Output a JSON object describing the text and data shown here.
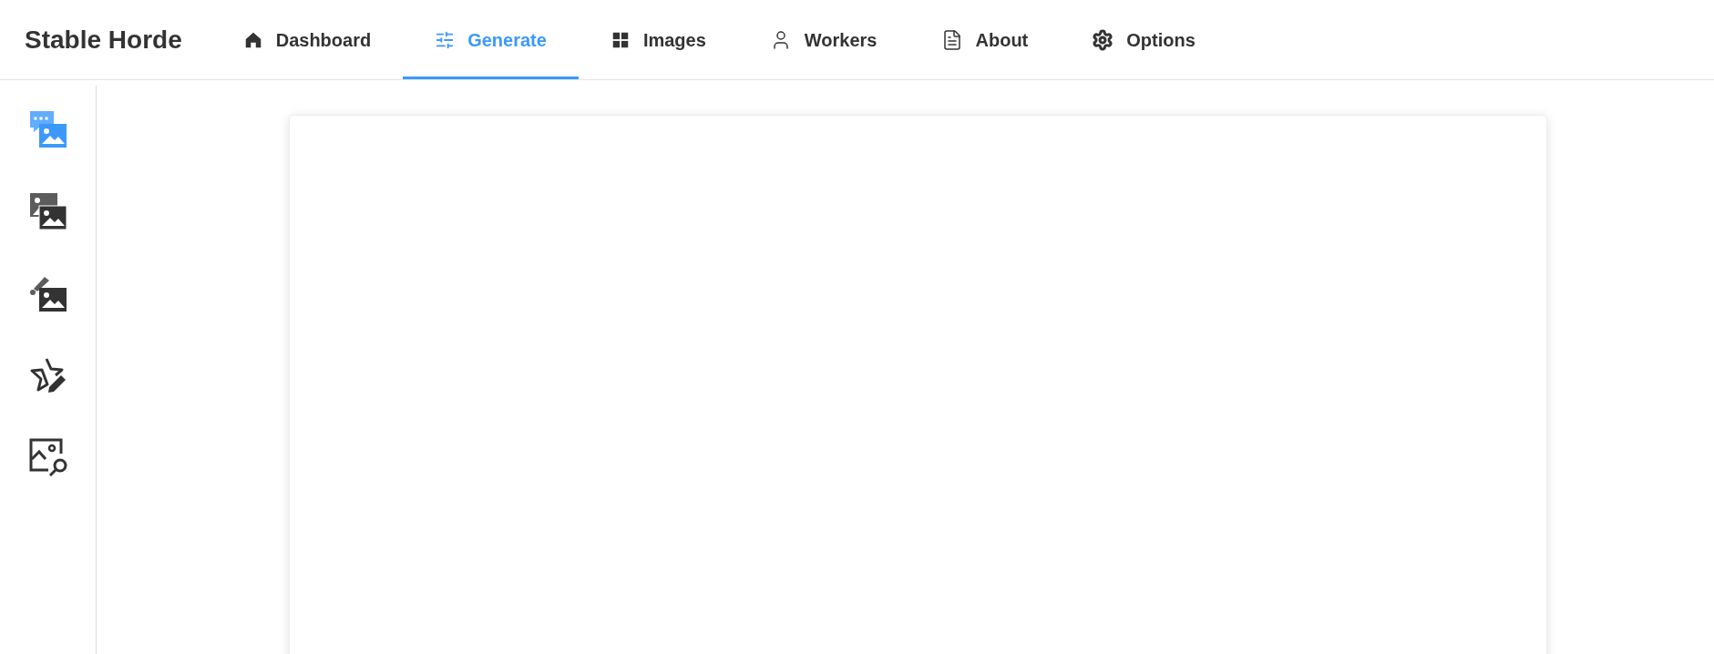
{
  "app_title": "Stable Horde",
  "tabs": [
    {
      "label": "Dashboard",
      "selected": false
    },
    {
      "label": "Generate",
      "selected": true
    },
    {
      "label": "Images",
      "selected": false
    },
    {
      "label": "Workers",
      "selected": false
    },
    {
      "label": "About",
      "selected": false
    },
    {
      "label": "Options",
      "selected": false
    }
  ],
  "sidebar": {
    "items": [
      {
        "selected": true
      },
      {
        "selected": false
      },
      {
        "selected": false
      },
      {
        "selected": false
      },
      {
        "selected": false
      }
    ]
  }
}
